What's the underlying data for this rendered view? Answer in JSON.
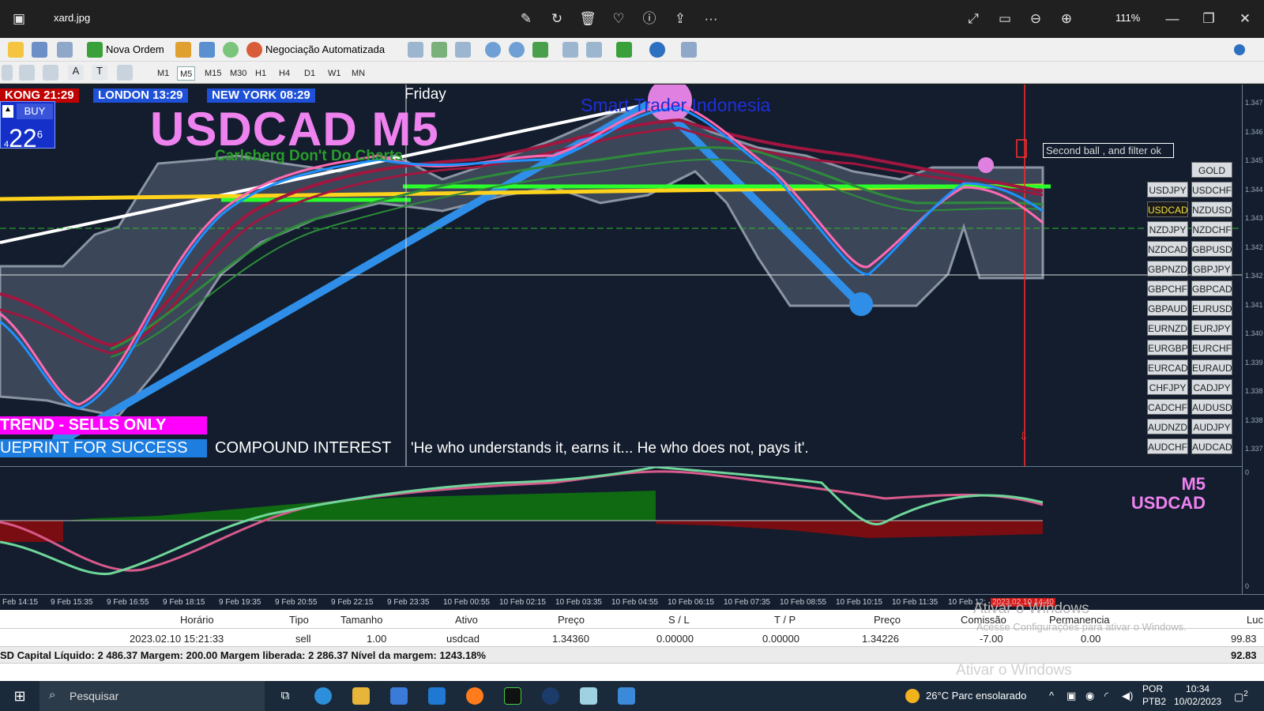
{
  "viewer": {
    "file_name": "xard.jpg",
    "zoom": "111%"
  },
  "toolbar": {
    "new_order": "Nova Ordem",
    "auto_trading": "Negociação Automatizada",
    "timeframes": [
      "M1",
      "M5",
      "M15",
      "M30",
      "H1",
      "H4",
      "D1",
      "W1",
      "MN"
    ],
    "active_timeframe": "M5"
  },
  "chart": {
    "sessions": [
      {
        "label": "KONG 21:29",
        "color": "#c00000"
      },
      {
        "label": "LONDON  13:29",
        "color": "#1e50d8"
      },
      {
        "label": "NEW YORK 08:29",
        "color": "#1e50d8"
      }
    ],
    "day_label": "Friday",
    "title": "USDCAD M5",
    "subtitle": "Carlsberg Don't Do Charts",
    "brand": "Smart Trader Indonesia",
    "note": "Second ball , and filter ok",
    "buy_label": "BUY",
    "buy_arrow": "▲",
    "buy_price_prefix": "4",
    "buy_price_main": "22",
    "buy_price_sup": "6",
    "trend_banner": "TREND - SELLS ONLY",
    "blueprint_banner": "UEPRINT FOR SUCCESS",
    "compound_text": "COMPOUND INTEREST",
    "quote": "'He who understands it, earns it... He who does not, pays it'.",
    "pairs": [
      "GOLD",
      "USDJPY",
      "USDCHF",
      "USDCAD",
      "NZDUSD",
      "NZDJPY",
      "NZDCHF",
      "NZDCAD",
      "GBPUSD",
      "GBPNZD",
      "GBPJPY",
      "GBPCHF",
      "GBPCAD",
      "GBPAUD",
      "EURUSD",
      "EURNZD",
      "EURJPY",
      "EURGBP",
      "EURCHF",
      "EURCAD",
      "EURAUD",
      "CHFJPY",
      "CADJPY",
      "CADCHF",
      "AUDUSD",
      "AUDNZD",
      "AUDJPY",
      "AUDCHF",
      "AUDCAD"
    ],
    "highlighted_pair": "USDCAD",
    "price_labels": [
      "1.347",
      "1.346",
      "1.345",
      "1.344",
      "1.343",
      "1.342",
      "1.342",
      "1.341",
      "1.340",
      "1.339",
      "1.338",
      "1.338",
      "1.337"
    ],
    "colors": {
      "background": "#131d2d",
      "cloud": "#4a5568",
      "blue_ma": "#1e90ff",
      "pink_ma": "#ff69b4",
      "crimson_ma": "#a0163f",
      "green_ma": "#2e8b3a",
      "yellow_level": "#ffd21c",
      "lime_level": "#2aff2a"
    }
  },
  "indicator": {
    "label_tf": "M5",
    "label_pair": "USDCAD",
    "axis_top": "0",
    "axis_bottom": "0"
  },
  "time_axis": [
    "Feb 14:15",
    "9 Feb 15:35",
    "9 Feb 16:55",
    "9 Feb 18:15",
    "9 Feb 19:35",
    "9 Feb 20:55",
    "9 Feb 22:15",
    "9 Feb 23:35",
    "10 Feb 00:55",
    "10 Feb 02:15",
    "10 Feb 03:35",
    "10 Feb 04:55",
    "10 Feb 06:15",
    "10 Feb 07:35",
    "10 Feb 08:55",
    "10 Feb 10:15",
    "10 Feb 11:35",
    "10 Feb 12:",
    "2023.02.10 14:40"
  ],
  "orders": {
    "headers": [
      "Horário",
      "Tipo",
      "Tamanho",
      "Ativo",
      "Preço",
      "S / L",
      "T / P",
      "Preço",
      "Comissão",
      "Permanencia",
      "Luc"
    ],
    "row": [
      "2023.02.10 15:21:33",
      "sell",
      "1.00",
      "usdcad",
      "1.34360",
      "0.00000",
      "0.00000",
      "1.34226",
      "-7.00",
      "0.00",
      "99.83"
    ],
    "summary": "SD  Capital Líquido: 2 486.37  Margem: 200.00  Margem liberada: 2 286.37  Nível da margem: 1243.18%",
    "summary_total": "92.83",
    "watermark_1": "Ativar o Windows",
    "watermark_2": "Acesse Configurações para ativar o Windows.",
    "watermark_3": "Ativar o Windows"
  },
  "taskbar": {
    "search": "Pesquisar",
    "weather": "26°C  Parc ensolarado",
    "lang_1": "POR",
    "lang_2": "PTB2",
    "time": "10:34",
    "date": "10/02/2023",
    "notifications": "2"
  }
}
